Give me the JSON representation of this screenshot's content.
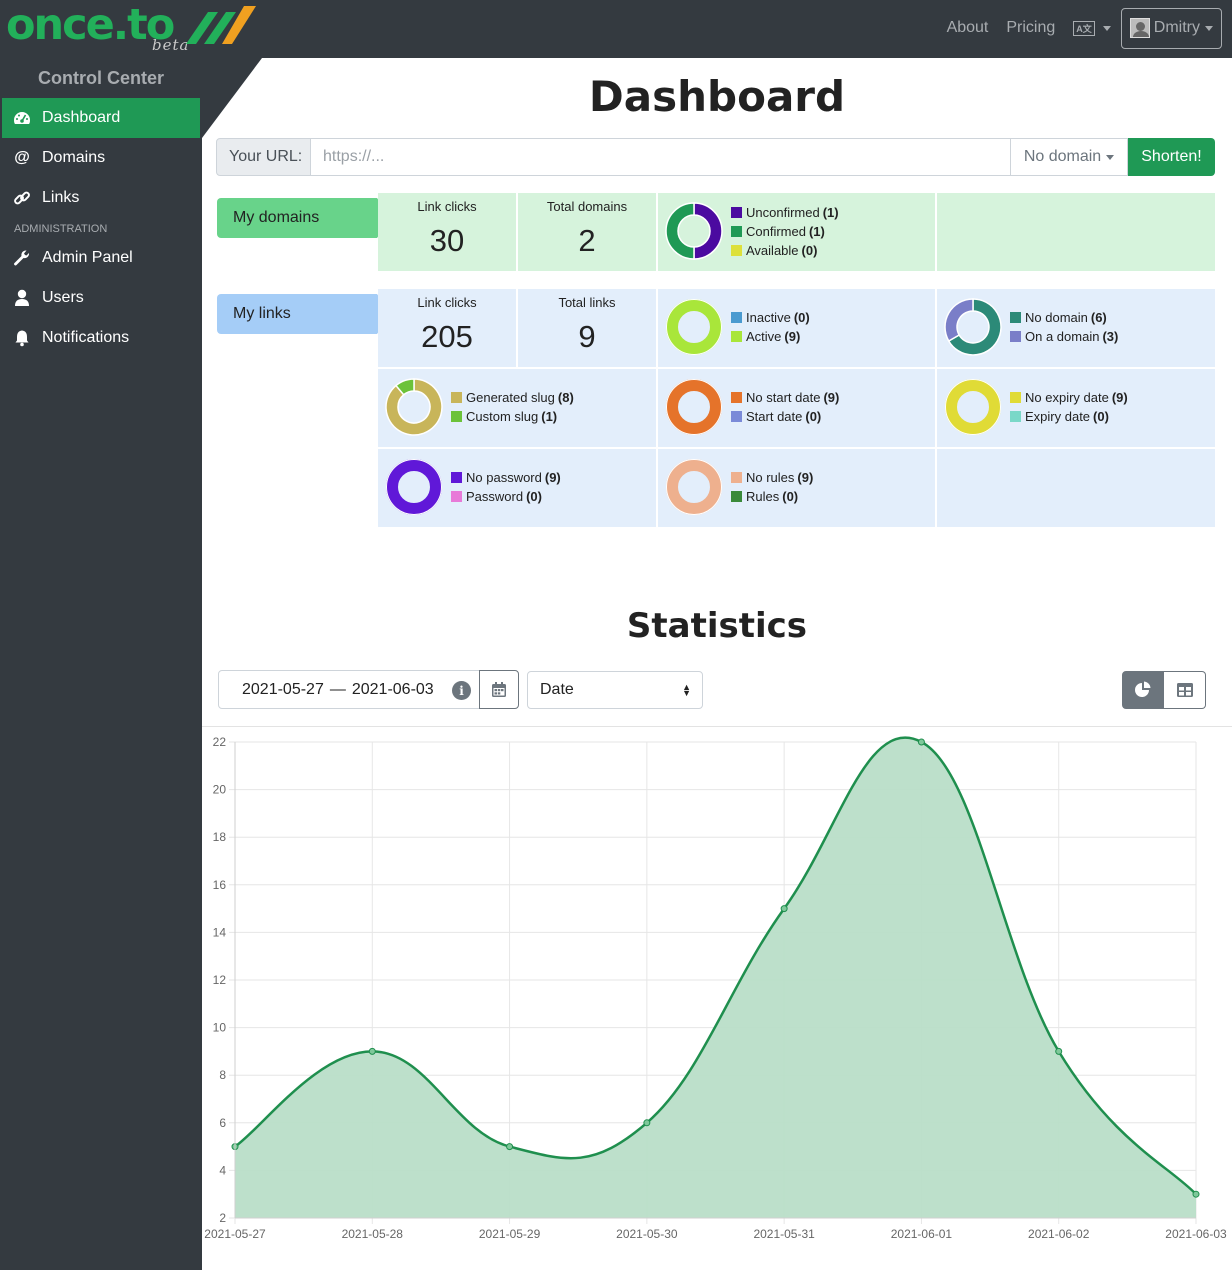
{
  "brand": {
    "logo_text": "once.to",
    "beta": "beta"
  },
  "topnav": {
    "about": "About",
    "pricing": "Pricing",
    "lang_icon": "language-icon",
    "user": "Dmitry"
  },
  "sidebar": {
    "title": "Control Center",
    "items": [
      {
        "label": "Dashboard",
        "icon": "tachometer-icon",
        "active": true
      },
      {
        "label": "Domains",
        "icon": "at-icon"
      },
      {
        "label": "Links",
        "icon": "link-icon"
      }
    ],
    "admin_heading": "ADMINISTRATION",
    "admin_items": [
      {
        "label": "Admin Panel",
        "icon": "wrench-icon"
      },
      {
        "label": "Users",
        "icon": "user-icon"
      },
      {
        "label": "Notifications",
        "icon": "bell-icon"
      }
    ]
  },
  "page": {
    "title": "Dashboard"
  },
  "shortener": {
    "label": "Your URL:",
    "placeholder": "https://...",
    "domain": "No domain",
    "button": "Shorten!"
  },
  "domains": {
    "tag": "My domains",
    "link_clicks_label": "Link clicks",
    "link_clicks": "30",
    "total_label": "Total domains",
    "total": "2",
    "chart": {
      "legend": [
        {
          "label": "Unconfirmed",
          "count": "(1)",
          "value": 1,
          "color": "#4b0aa0"
        },
        {
          "label": "Confirmed",
          "count": "(1)",
          "value": 1,
          "color": "#1f9955"
        },
        {
          "label": "Available",
          "count": "(0)",
          "value": 0,
          "color": "#dde03a"
        }
      ]
    }
  },
  "links": {
    "tag": "My links",
    "link_clicks_label": "Link clicks",
    "link_clicks": "205",
    "total_label": "Total links",
    "total": "9",
    "charts": [
      {
        "legend": [
          {
            "label": "Inactive",
            "count": "(0)",
            "value": 0,
            "color": "#4a9ad0"
          },
          {
            "label": "Active",
            "count": "(9)",
            "value": 9,
            "color": "#a9e63a"
          }
        ]
      },
      {
        "legend": [
          {
            "label": "No domain",
            "count": "(6)",
            "value": 6,
            "color": "#2c8a78"
          },
          {
            "label": "On a domain",
            "count": "(3)",
            "value": 3,
            "color": "#7a7ec8"
          }
        ]
      },
      {
        "legend": [
          {
            "label": "Generated slug",
            "count": "(8)",
            "value": 8,
            "color": "#c8b55a"
          },
          {
            "label": "Custom slug",
            "count": "(1)",
            "value": 1,
            "color": "#6cc23a"
          }
        ]
      },
      {
        "legend": [
          {
            "label": "No start date",
            "count": "(9)",
            "value": 9,
            "color": "#e5732a"
          },
          {
            "label": "Start date",
            "count": "(0)",
            "value": 0,
            "color": "#7a8ad8"
          }
        ]
      },
      {
        "legend": [
          {
            "label": "No expiry date",
            "count": "(9)",
            "value": 9,
            "color": "#e0db36"
          },
          {
            "label": "Expiry date",
            "count": "(0)",
            "value": 0,
            "color": "#7ad8c8"
          }
        ]
      },
      {
        "legend": [
          {
            "label": "No password",
            "count": "(9)",
            "value": 9,
            "color": "#6018d8"
          },
          {
            "label": "Password",
            "count": "(0)",
            "value": 0,
            "color": "#e87ad8"
          }
        ]
      },
      {
        "legend": [
          {
            "label": "No rules",
            "count": "(9)",
            "value": 9,
            "color": "#eeb08e"
          },
          {
            "label": "Rules",
            "count": "(0)",
            "value": 0,
            "color": "#3a8a3a"
          }
        ]
      }
    ]
  },
  "statistics": {
    "title": "Statistics",
    "date_from": "2021-05-27",
    "date_sep": "—",
    "date_to": "2021-06-03",
    "group_by": "Date"
  },
  "chart_data": {
    "type": "area",
    "x": [
      "2021-05-27",
      "2021-05-28",
      "2021-05-29",
      "2021-05-30",
      "2021-05-31",
      "2021-06-01",
      "2021-06-02",
      "2021-06-03"
    ],
    "series": [
      {
        "values": [
          5,
          9,
          5,
          6,
          15,
          22,
          9,
          3
        ]
      }
    ],
    "ylim": [
      2,
      22
    ],
    "yticks": [
      "2",
      "4",
      "6",
      "8",
      "10",
      "12",
      "14",
      "16",
      "18",
      "20",
      "22"
    ],
    "grid": true,
    "line_color": "#1f8f4e",
    "fill_color": "#b9dec8"
  }
}
